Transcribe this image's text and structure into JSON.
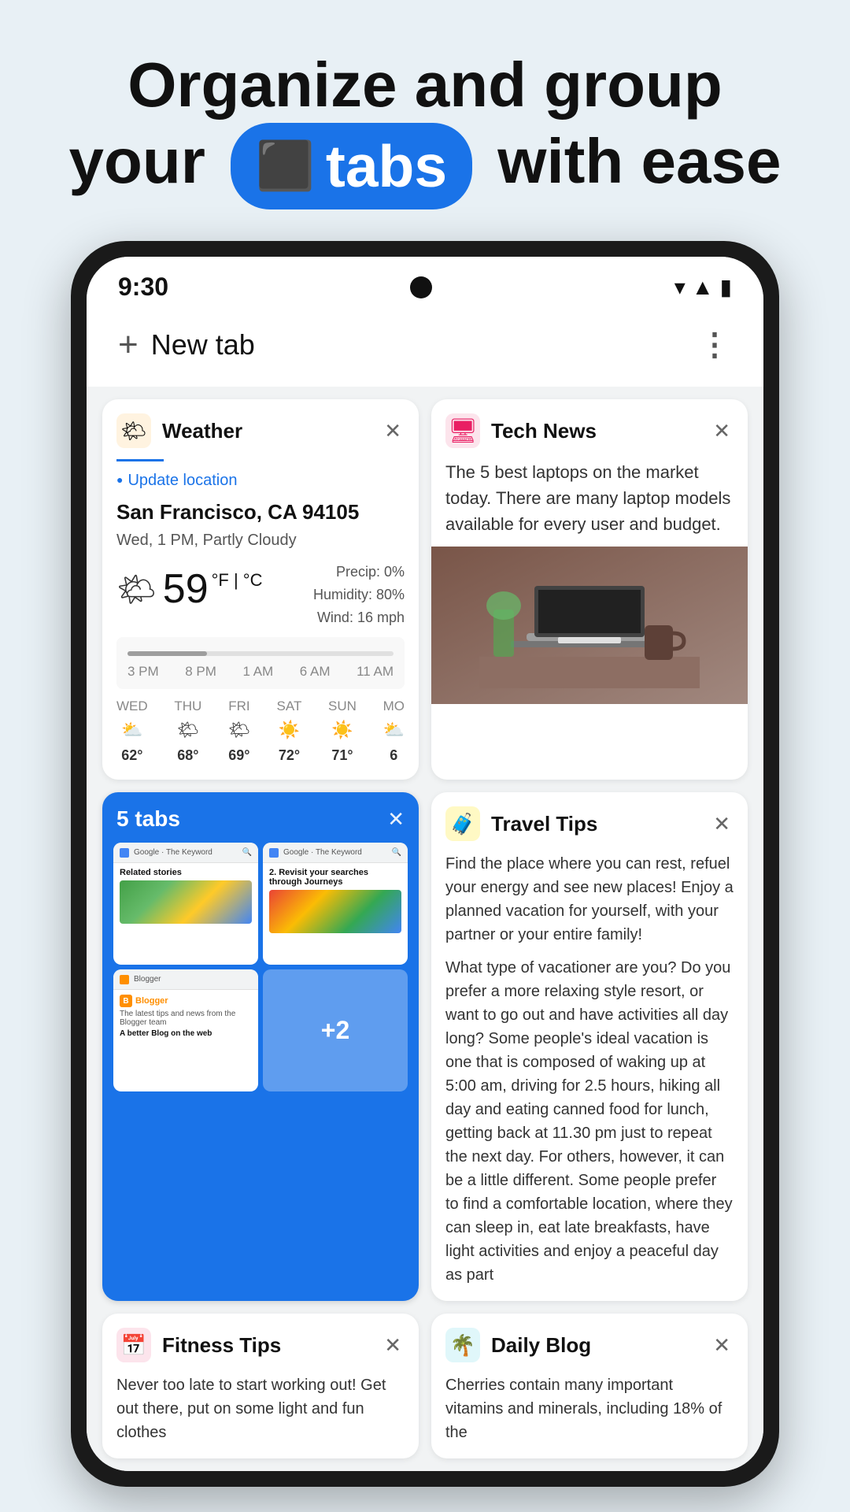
{
  "hero": {
    "line1": "Organize and group",
    "line2_pre": "your",
    "badge_icon": "⬜",
    "badge_text": "tabs",
    "line2_post": "with ease"
  },
  "phone": {
    "status_bar": {
      "time": "9:30",
      "signal": "▲",
      "battery": "🔋"
    },
    "chrome_bar": {
      "new_tab_label": "New tab",
      "plus": "+",
      "menu_dots": "⋮"
    },
    "cards": {
      "weather": {
        "title": "Weather",
        "update_location": "Update location",
        "city": "San Francisco, CA 94105",
        "desc": "Wed, 1 PM, Partly Cloudy",
        "temp": "59",
        "temp_unit": "°F | °C",
        "precip": "Precip: 0%",
        "humidity": "Humidity: 80%",
        "wind": "Wind: 16 mph",
        "timeline_labels": [
          "3 PM",
          "8 PM",
          "1 AM",
          "6 AM",
          "11 AM"
        ],
        "forecast": [
          {
            "day": "WED",
            "emoji": "⛅",
            "temp": "62°"
          },
          {
            "day": "THU",
            "emoji": "🌤",
            "temp": "68°"
          },
          {
            "day": "FRI",
            "emoji": "🌤",
            "temp": "69°"
          },
          {
            "day": "SAT",
            "emoji": "☀️",
            "temp": "72°"
          },
          {
            "day": "SUN",
            "emoji": "☀️",
            "temp": "71°"
          },
          {
            "day": "MO",
            "emoji": "⛅",
            "temp": "6"
          }
        ],
        "close": "✕"
      },
      "tech_news": {
        "title": "Tech News",
        "text": "The 5 best laptops on the market today. There are many laptop models available for every user and budget.",
        "close": "✕"
      },
      "tabs_group": {
        "count_label": "5 tabs",
        "close": "✕",
        "plus_badge": "+2",
        "mini_tabs": [
          {
            "favicon_color": "#4285f4",
            "url": "The Keyword",
            "headline": "Related stories",
            "img_type": "map"
          },
          {
            "favicon_color": "#4285f4",
            "url": "The Keyword",
            "headline": "2. Revisit your searches through Journeys",
            "img_type": "google"
          },
          {
            "favicon_color": "#ff8f00",
            "url": "Blogger",
            "headline": "A better Blog on the web",
            "img_type": "blogger"
          }
        ]
      },
      "travel_tips": {
        "title": "Travel Tips",
        "text1": "Find the place where you can rest, refuel your energy and see new places! Enjoy a planned vacation for yourself, with your partner or your entire family!",
        "text2": "What type of vacationer are you? Do you prefer a more relaxing style resort, or want to go out and have activities all day long? Some people's ideal vacation is one that is composed of waking up at 5:00 am, driving for 2.5 hours, hiking all day and eating canned food for lunch, getting back at 11.30 pm just to repeat the next day. For others, however, it can be a little different. Some people prefer to find a comfortable location, where they can sleep in, eat late breakfasts, have light activities and enjoy a peaceful day as part",
        "close": "✕"
      },
      "fitness_tips": {
        "title": "Fitness Tips",
        "text": "Never too late to start working out! Get out there, put on some light and fun clothes",
        "close": "✕"
      },
      "daily_blog": {
        "title": "Daily Blog",
        "text": "Cherries contain many important vitamins and minerals, including 18% of the",
        "close": "✕"
      }
    }
  }
}
